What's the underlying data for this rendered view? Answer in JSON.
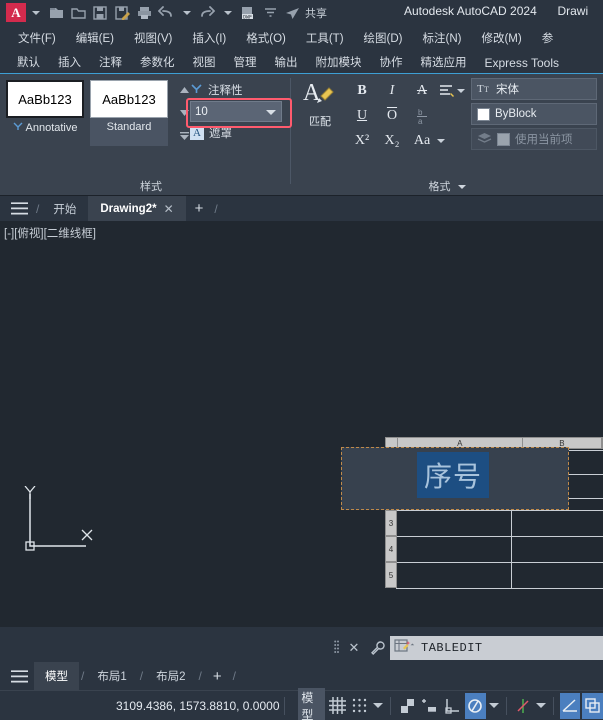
{
  "titlebar": {
    "logo_text": "A",
    "product_title": "Autodesk AutoCAD 2024",
    "document_title": "Drawi",
    "share_label": "共享",
    "icons": [
      "app-menu-icon",
      "dropdown-caret-icon",
      "new-file-icon",
      "open-folder-icon",
      "save-icon",
      "save-as-icon",
      "plot-icon",
      "undo-icon",
      "redo-icon",
      "dwf-icon",
      "customize-caret-icon",
      "share-send-icon"
    ]
  },
  "menubar": {
    "items": [
      {
        "label": "文件(F)",
        "name": "menu-file"
      },
      {
        "label": "编辑(E)",
        "name": "menu-edit"
      },
      {
        "label": "视图(V)",
        "name": "menu-view"
      },
      {
        "label": "插入(I)",
        "name": "menu-insert"
      },
      {
        "label": "格式(O)",
        "name": "menu-format"
      },
      {
        "label": "工具(T)",
        "name": "menu-tools"
      },
      {
        "label": "绘图(D)",
        "name": "menu-draw"
      },
      {
        "label": "标注(N)",
        "name": "menu-dimension"
      },
      {
        "label": "修改(M)",
        "name": "menu-modify"
      },
      {
        "label": "参",
        "name": "menu-parametric"
      }
    ]
  },
  "ribbon_tabs": {
    "items": [
      {
        "label": "默认",
        "name": "ribbontab-home"
      },
      {
        "label": "插入",
        "name": "ribbontab-insert"
      },
      {
        "label": "注释",
        "name": "ribbontab-annotate"
      },
      {
        "label": "参数化",
        "name": "ribbontab-parametric"
      },
      {
        "label": "视图",
        "name": "ribbontab-view"
      },
      {
        "label": "管理",
        "name": "ribbontab-manage"
      },
      {
        "label": "输出",
        "name": "ribbontab-output"
      },
      {
        "label": "附加模块",
        "name": "ribbontab-addins"
      },
      {
        "label": "协作",
        "name": "ribbontab-collaborate"
      },
      {
        "label": "精选应用",
        "name": "ribbontab-featured-apps"
      },
      {
        "label": "Express Tools",
        "name": "ribbontab-express-tools"
      }
    ]
  },
  "ribbon": {
    "style_panel": {
      "title": "样式",
      "gallery": [
        {
          "preview": "AaBb123",
          "name": "Annotative"
        },
        {
          "preview": "AaBb123",
          "name": "Standard"
        }
      ],
      "annotative_label": "注释性",
      "text_height_value": "10",
      "text_height_placeholder": "10",
      "mask_label": "遮罩",
      "mask_icon_letter": "A",
      "highlight_color": "#ff5b6e"
    },
    "format_panel": {
      "title": "格式",
      "match_label": "匹配",
      "buttons": [
        {
          "label": "B",
          "name": "bold-button"
        },
        {
          "label": "I",
          "name": "italic-button"
        },
        {
          "label": "A",
          "name": "strikethrough-button"
        },
        {
          "label": "≡",
          "name": "justify-button"
        },
        {
          "label": "U",
          "name": "underline-button"
        },
        {
          "label": "O",
          "name": "overline-button"
        },
        {
          "label": "b/a",
          "name": "stack-fraction-button"
        },
        {
          "label": "X²",
          "name": "superscript-button"
        },
        {
          "label": "X₂",
          "name": "subscript-button"
        },
        {
          "label": "Aa",
          "name": "change-case-button"
        }
      ],
      "font_value": "宋体",
      "color_value": "ByBlock",
      "layer_value": "使用当前项"
    }
  },
  "filetabs": {
    "start_label": "开始",
    "drawing_label": "Drawing2*",
    "close_glyph": "✕",
    "plus_glyph": "+"
  },
  "canvas": {
    "viewport_label": "[-][俯视][二维线框]",
    "ucs_x_label": "X",
    "ucs_y_label": "Y",
    "background_color": "#212830",
    "table": {
      "column_headers": [
        "",
        "A",
        "B"
      ],
      "row_headers": [
        "3",
        "4",
        "5"
      ],
      "edited_cell_text": "序号",
      "selection_color": "#1d4e82",
      "editor_border_color": "#c08a4a"
    }
  },
  "command_line": {
    "command_text": "TABLEDIT",
    "close_glyph": "✕",
    "wrench_glyph": "🔧"
  },
  "layout_tabs": {
    "items": [
      {
        "label": "模型",
        "name": "layouttab-model",
        "active": true
      },
      {
        "label": "布局1",
        "name": "layouttab-layout1",
        "active": false
      },
      {
        "label": "布局2",
        "name": "layouttab-layout2",
        "active": false
      }
    ],
    "plus_glyph": "+"
  },
  "statusbar": {
    "coordinates": "3109.4386, 1573.8810, 0.0000",
    "space_label": "模型",
    "icons": [
      {
        "name": "grid-display-icon",
        "on": false
      },
      {
        "name": "snap-mode-icon",
        "on": false
      },
      {
        "name": "ortho-mode-icon",
        "on": false
      },
      {
        "name": "polar-tracking-icon",
        "on": false
      },
      {
        "name": "object-snap-icon",
        "on": false
      },
      {
        "name": "osnap-tracking-icon",
        "on": true
      },
      {
        "name": "dynamic-ucs-icon",
        "on": false
      },
      {
        "name": "lineweight-icon",
        "on": true
      },
      {
        "name": "transparency-icon",
        "on": true
      }
    ]
  }
}
